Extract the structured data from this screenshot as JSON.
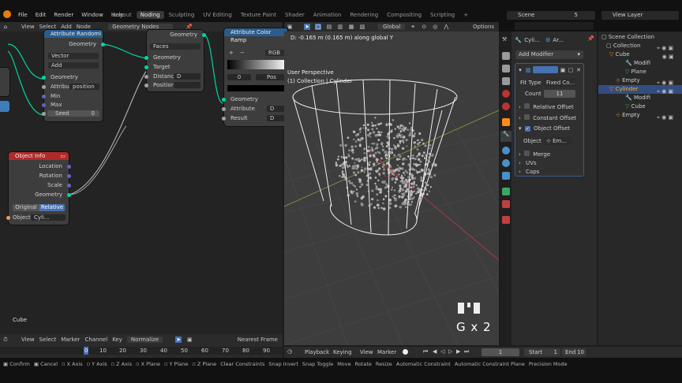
{
  "menu": {
    "items": [
      "File",
      "Edit",
      "Render",
      "Window",
      "Help"
    ]
  },
  "workspaces": [
    "Layout",
    "Noding",
    "Sculpting",
    "UV Editing",
    "Texture Paint",
    "Shader",
    "Animation",
    "Rendering",
    "Compositing",
    "Scripting"
  ],
  "active_workspace": "Noding",
  "scene": {
    "label": "Scene",
    "users": "5",
    "view_layer": "View Layer"
  },
  "node_editor": {
    "header": [
      "View",
      "Select",
      "Add",
      "Node"
    ],
    "tree_name": "Geometry Nodes",
    "attr_node": {
      "title": "Attribute Randomi",
      "out": "Geometry",
      "type": "Vector",
      "op": "Add",
      "inputs": [
        "Geometry",
        "Attribute",
        "Min",
        "Max"
      ],
      "attr_value": "position",
      "seed_label": "Seed",
      "seed_value": "0"
    },
    "mid_node": {
      "out": "Geometry",
      "domain": "Faces",
      "inputs": [
        "Geometry",
        "Target",
        "Distanc",
        "Position"
      ],
      "dist_value": "D"
    },
    "color_node": {
      "title": "Attribute Color Ramp",
      "mode": "RGB",
      "pos0": "0",
      "pos_label": "Pos",
      "inputs": [
        "Geometry",
        "Attribute",
        "Result"
      ],
      "attr_val": "D",
      "result_val": "D"
    },
    "obj_info": {
      "title": "Object Info",
      "outputs": [
        "Location",
        "Rotation",
        "Scale",
        "Geometry"
      ],
      "btn_original": "Original",
      "btn_relative": "Relative",
      "object_label": "Object:",
      "object_value": "Cyli..."
    },
    "footer_label": "Cube"
  },
  "viewport": {
    "transform": "Global",
    "options": "Options",
    "status_line": "D: -0.165 m (0.165 m) along global Y",
    "view_name": "User Perspective",
    "collection": "(1) Collection | Cylinder",
    "key_overlay": "G x 2"
  },
  "properties": {
    "object_name": "Cyli...",
    "modifier_tab": "Ar...",
    "add_modifier": "Add Modifier",
    "fit_type_label": "Fit Type",
    "fit_type_value": "Fixed Co...",
    "count_label": "Count",
    "count_value": "11",
    "relative_offset": "Relative Offset",
    "constant_offset": "Constant Offset",
    "object_offset": "Object Offset",
    "object_label": "Object",
    "object_value": "Em...",
    "merge": "Merge",
    "uvs": "UVs",
    "caps": "Caps"
  },
  "outliner": {
    "items": [
      "Scene Collection",
      "Collection",
      "Cube",
      "Modifi",
      "Plane",
      "Empty",
      "Cylinder",
      "Modifi",
      "Cube",
      "Empty"
    ]
  },
  "timeline": {
    "header": [
      "View",
      "Select",
      "Marker",
      "Channel",
      "Key"
    ],
    "normalize": "Normalize",
    "nearest": "Nearest Frame",
    "ticks": [
      "0",
      "10",
      "20",
      "30",
      "40",
      "50",
      "60",
      "70",
      "80",
      "90"
    ],
    "playback": "Playback",
    "keying": "Keying",
    "view": "View",
    "marker": "Marker",
    "current_frame": "1",
    "start_label": "Start",
    "start": "1",
    "end_label": "End",
    "end": "10"
  },
  "statusbar": {
    "items": [
      "Confirm",
      "Cancel",
      "X Axis",
      "Y Axis",
      "Z Axis",
      "X Plane",
      "Y Plane",
      "Z Plane",
      "Clear Constraints",
      "Snap Invert",
      "Snap Toggle",
      "Move",
      "Rotate",
      "Resize",
      "Automatic Constraint",
      "Automatic Constraint Plane",
      "Precision Mode"
    ]
  },
  "colors": {
    "node_header_attr": "#2a5d8e",
    "node_header_obj": "#b02a2a",
    "socket_geometry": "#00d6a3",
    "socket_vector": "#6363c7",
    "socket_float": "#a1a1a1",
    "socket_object": "#ed9e5c",
    "selection": "#4772b3",
    "active": "#ffaf29"
  }
}
